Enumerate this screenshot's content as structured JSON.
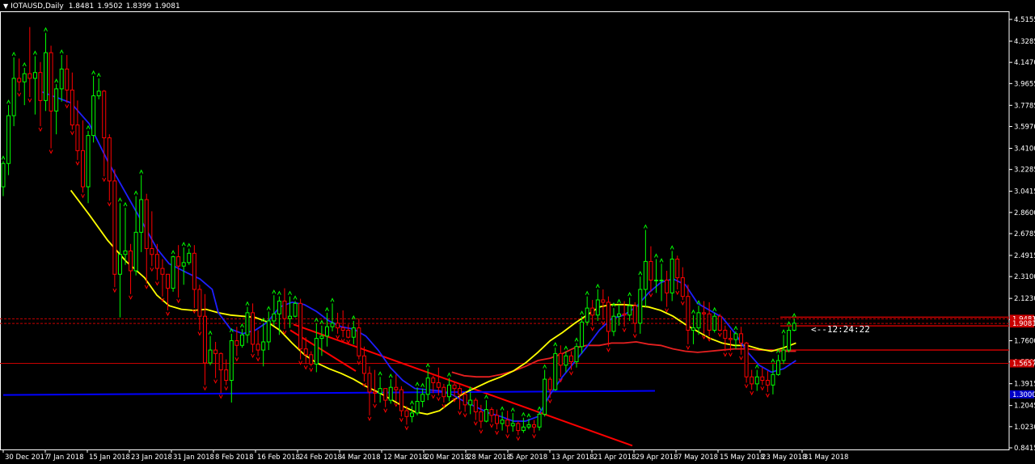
{
  "header": {
    "symbol": "IOTAUSD,Daily",
    "open": "1.8481",
    "high": "1.9502",
    "low": "1.8399",
    "close": "1.9081"
  },
  "countdown": "<--12:24:22",
  "colors": {
    "background": "#000000",
    "bull": "#00ff00",
    "bear": "#ff0000",
    "ma_fast": "#1e1eff",
    "ma_mid": "#ffff00",
    "ma_slow": "#e62020",
    "trend_red": "#ff0000",
    "trend_blue": "#0000ff",
    "hline_red": "#c80000",
    "axis": "#ffffff"
  },
  "chart_data": {
    "type": "candlestick",
    "title": "IOTAUSD,Daily",
    "ylim": [
      0.8415,
      4.5155
    ],
    "y_ticks": [
      "4.5155",
      "4.3285",
      "4.1470",
      "3.9655",
      "3.7785",
      "3.5970",
      "3.4100",
      "3.2285",
      "3.0415",
      "2.8600",
      "2.6785",
      "2.4915",
      "2.3100",
      "2.1230",
      "1.9415",
      "1.7600",
      "1.5785",
      "1.3915",
      "1.2045",
      "1.0230",
      "0.8415"
    ],
    "x_ticks": [
      "30 Dec 2017",
      "7 Jan 2018",
      "15 Jan 2018",
      "23 Jan 2018",
      "31 Jan 2018",
      "8 Feb 2018",
      "16 Feb 2018",
      "24 Feb 2018",
      "4 Mar 2018",
      "12 Mar 2018",
      "20 Mar 2018",
      "28 Mar 2018",
      "5 Apr 2018",
      "13 Apr 2018",
      "21 Apr 2018",
      "29 Apr 2018",
      "7 May 2018",
      "15 May 2018",
      "23 May 2018",
      "31 May 2018"
    ],
    "price_badges": [
      {
        "value": "1.9481",
        "color": "#c80000"
      },
      {
        "value": "1.9081",
        "color": "#c80000"
      },
      {
        "value": "1.5657",
        "color": "#c80000"
      },
      {
        "value": "1.3000",
        "color": "#0000c8"
      }
    ],
    "horizontal_lines": [
      {
        "y": 1.948,
        "color": "#c80000",
        "style": "dashed"
      },
      {
        "y": 1.908,
        "color": "#c80000",
        "style": "dashed"
      },
      {
        "y": 1.566,
        "color": "#c80000",
        "style": "solid"
      }
    ],
    "candles": [
      [
        3.08,
        3.28,
        3.0,
        3.3
      ],
      [
        3.28,
        3.69,
        3.18,
        3.78
      ],
      [
        3.69,
        4.01,
        3.6,
        4.19
      ],
      [
        4.01,
        3.98,
        3.9,
        4.18
      ],
      [
        3.98,
        4.05,
        3.78,
        4.1
      ],
      [
        4.05,
        4.01,
        3.85,
        4.45
      ],
      [
        4.01,
        4.06,
        3.7,
        4.2
      ],
      [
        4.06,
        3.82,
        3.6,
        4.15
      ],
      [
        3.82,
        4.23,
        3.73,
        4.4
      ],
      [
        4.23,
        3.73,
        3.41,
        4.29
      ],
      [
        3.73,
        3.92,
        3.53,
        3.96
      ],
      [
        3.92,
        4.09,
        3.81,
        4.21
      ],
      [
        4.09,
        3.91,
        3.8,
        4.21
      ],
      [
        3.91,
        3.61,
        3.57,
        4.06
      ],
      [
        3.61,
        3.39,
        3.31,
        3.82
      ],
      [
        3.39,
        3.08,
        3.03,
        3.65
      ],
      [
        3.08,
        3.52,
        2.94,
        3.56
      ],
      [
        3.52,
        3.86,
        3.46,
        4.03
      ],
      [
        3.86,
        3.9,
        3.83,
        4.01
      ],
      [
        3.9,
        3.5,
        3.17,
        3.91
      ],
      [
        3.5,
        3.13,
        2.96,
        3.53
      ],
      [
        3.13,
        2.33,
        2.22,
        3.23
      ],
      [
        2.33,
        2.5,
        1.96,
        2.94
      ],
      [
        2.5,
        2.53,
        2.41,
        2.9
      ],
      [
        2.53,
        2.36,
        2.16,
        2.59
      ],
      [
        2.36,
        2.69,
        2.32,
        3.0
      ],
      [
        2.69,
        2.97,
        2.52,
        3.18
      ],
      [
        2.97,
        2.55,
        2.25,
        3.02
      ],
      [
        2.55,
        2.5,
        2.4,
        2.87
      ],
      [
        2.5,
        2.38,
        2.28,
        2.59
      ],
      [
        2.38,
        2.33,
        2.14,
        2.46
      ],
      [
        2.33,
        2.21,
        2.02,
        2.33
      ],
      [
        2.21,
        2.48,
        2.18,
        2.49
      ],
      [
        2.48,
        2.4,
        2.13,
        2.58
      ],
      [
        2.4,
        2.43,
        2.24,
        2.56
      ],
      [
        2.43,
        2.51,
        2.41,
        2.55
      ],
      [
        2.51,
        2.2,
        2.04,
        2.58
      ],
      [
        2.2,
        1.97,
        1.85,
        2.24
      ],
      [
        1.97,
        1.57,
        1.38,
        2.16
      ],
      [
        1.57,
        1.68,
        1.55,
        1.8
      ],
      [
        1.68,
        1.65,
        1.44,
        1.75
      ],
      [
        1.65,
        1.51,
        1.31,
        1.66
      ],
      [
        1.51,
        1.42,
        1.38,
        1.6
      ],
      [
        1.42,
        1.76,
        1.23,
        1.82
      ],
      [
        1.76,
        1.72,
        1.63,
        1.88
      ],
      [
        1.72,
        1.81,
        1.7,
        1.86
      ],
      [
        1.81,
        2.0,
        1.74,
        2.05
      ],
      [
        2.0,
        1.73,
        1.66,
        2.08
      ],
      [
        1.73,
        1.68,
        1.63,
        1.85
      ],
      [
        1.68,
        1.75,
        1.54,
        1.91
      ],
      [
        1.75,
        1.93,
        1.68,
        2.01
      ],
      [
        1.93,
        1.99,
        1.89,
        2.15
      ],
      [
        1.99,
        2.1,
        1.81,
        2.14
      ],
      [
        2.1,
        1.95,
        1.86,
        2.21
      ],
      [
        1.95,
        1.97,
        1.87,
        2.14
      ],
      [
        1.97,
        2.08,
        1.96,
        2.1
      ],
      [
        2.08,
        1.69,
        1.6,
        2.12
      ],
      [
        1.69,
        1.64,
        1.56,
        1.79
      ],
      [
        1.64,
        1.56,
        1.54,
        1.67
      ],
      [
        1.56,
        1.78,
        1.49,
        1.91
      ],
      [
        1.78,
        1.8,
        1.63,
        1.89
      ],
      [
        1.8,
        1.88,
        1.71,
        2.0
      ],
      [
        1.88,
        1.91,
        1.84,
        2.08
      ],
      [
        1.91,
        1.87,
        1.82,
        2.0
      ],
      [
        1.87,
        1.85,
        1.79,
        2.02
      ],
      [
        1.85,
        1.79,
        1.78,
        1.9
      ],
      [
        1.79,
        1.87,
        1.73,
        1.93
      ],
      [
        1.87,
        1.63,
        1.6,
        1.95
      ],
      [
        1.63,
        1.48,
        1.41,
        1.71
      ],
      [
        1.48,
        1.32,
        1.12,
        1.54
      ],
      [
        1.32,
        1.31,
        1.23,
        1.51
      ],
      [
        1.31,
        1.35,
        1.23,
        1.45
      ],
      [
        1.35,
        1.25,
        1.19,
        1.35
      ],
      [
        1.25,
        1.36,
        1.22,
        1.43
      ],
      [
        1.36,
        1.34,
        1.24,
        1.47
      ],
      [
        1.34,
        1.16,
        1.11,
        1.37
      ],
      [
        1.16,
        1.11,
        1.04,
        1.2
      ],
      [
        1.11,
        1.14,
        1.06,
        1.2
      ],
      [
        1.14,
        1.24,
        1.12,
        1.36
      ],
      [
        1.24,
        1.3,
        1.19,
        1.35
      ],
      [
        1.3,
        1.44,
        1.25,
        1.52
      ],
      [
        1.44,
        1.4,
        1.31,
        1.46
      ],
      [
        1.4,
        1.36,
        1.29,
        1.53
      ],
      [
        1.36,
        1.28,
        1.23,
        1.39
      ],
      [
        1.28,
        1.38,
        1.24,
        1.44
      ],
      [
        1.38,
        1.35,
        1.28,
        1.41
      ],
      [
        1.35,
        1.3,
        1.17,
        1.38
      ],
      [
        1.3,
        1.21,
        1.15,
        1.32
      ],
      [
        1.21,
        1.25,
        1.13,
        1.32
      ],
      [
        1.25,
        1.15,
        1.08,
        1.27
      ],
      [
        1.15,
        1.07,
        1.01,
        1.21
      ],
      [
        1.07,
        1.17,
        1.06,
        1.25
      ],
      [
        1.17,
        1.12,
        1.06,
        1.19
      ],
      [
        1.12,
        1.05,
        1.0,
        1.17
      ],
      [
        1.05,
        1.08,
        0.99,
        1.15
      ],
      [
        1.08,
        1.03,
        0.97,
        1.16
      ],
      [
        1.03,
        1.05,
        0.98,
        1.14
      ],
      [
        1.05,
        0.99,
        0.95,
        1.07
      ],
      [
        0.99,
        1.02,
        0.97,
        1.1
      ],
      [
        1.02,
        1.04,
        1.0,
        1.09
      ],
      [
        1.04,
        1.02,
        0.97,
        1.08
      ],
      [
        1.02,
        1.13,
        0.99,
        1.15
      ],
      [
        1.13,
        1.43,
        1.11,
        1.51
      ],
      [
        1.43,
        1.34,
        1.27,
        1.45
      ],
      [
        1.34,
        1.65,
        1.33,
        1.7
      ],
      [
        1.65,
        1.55,
        1.45,
        1.72
      ],
      [
        1.55,
        1.63,
        1.49,
        1.67
      ],
      [
        1.63,
        1.58,
        1.51,
        1.67
      ],
      [
        1.58,
        1.71,
        1.53,
        1.74
      ],
      [
        1.71,
        1.92,
        1.65,
        1.97
      ],
      [
        1.92,
        2.04,
        1.89,
        2.14
      ],
      [
        2.04,
        1.98,
        1.89,
        2.11
      ],
      [
        1.98,
        2.11,
        1.93,
        2.2
      ],
      [
        2.11,
        2.09,
        1.94,
        2.2
      ],
      [
        2.09,
        1.84,
        1.71,
        2.14
      ],
      [
        1.84,
        1.97,
        1.8,
        2.04
      ],
      [
        1.97,
        1.99,
        1.89,
        2.07
      ],
      [
        1.99,
        1.98,
        1.88,
        2.1
      ],
      [
        1.98,
        2.06,
        1.93,
        2.13
      ],
      [
        2.06,
        1.91,
        1.83,
        2.09
      ],
      [
        1.91,
        2.2,
        1.82,
        2.31
      ],
      [
        2.2,
        2.44,
        2.05,
        2.71
      ],
      [
        2.44,
        2.28,
        2.18,
        2.57
      ],
      [
        2.28,
        2.28,
        2.17,
        2.46
      ],
      [
        2.28,
        2.28,
        2.1,
        2.42
      ],
      [
        2.28,
        2.17,
        2.05,
        2.36
      ],
      [
        2.17,
        2.46,
        2.1,
        2.53
      ],
      [
        2.46,
        2.3,
        2.2,
        2.49
      ],
      [
        2.3,
        2.14,
        2.11,
        2.39
      ],
      [
        2.14,
        1.85,
        1.73,
        2.24
      ],
      [
        1.85,
        1.87,
        1.73,
        1.98
      ],
      [
        1.87,
        2.0,
        1.81,
        2.06
      ],
      [
        2.0,
        1.99,
        1.82,
        2.1
      ],
      [
        1.99,
        1.85,
        1.8,
        2.09
      ],
      [
        1.85,
        1.97,
        1.83,
        2.0
      ],
      [
        1.97,
        1.85,
        1.84,
        1.99
      ],
      [
        1.85,
        1.78,
        1.67,
        1.89
      ],
      [
        1.78,
        1.77,
        1.67,
        1.85
      ],
      [
        1.77,
        1.82,
        1.69,
        1.84
      ],
      [
        1.82,
        1.74,
        1.64,
        1.88
      ],
      [
        1.74,
        1.45,
        1.4,
        1.75
      ],
      [
        1.45,
        1.39,
        1.34,
        1.51
      ],
      [
        1.39,
        1.45,
        1.33,
        1.51
      ],
      [
        1.45,
        1.42,
        1.38,
        1.53
      ],
      [
        1.42,
        1.38,
        1.32,
        1.5
      ],
      [
        1.38,
        1.47,
        1.3,
        1.56
      ],
      [
        1.47,
        1.59,
        1.46,
        1.64
      ],
      [
        1.59,
        1.68,
        1.56,
        1.81
      ],
      [
        1.68,
        1.85,
        1.66,
        1.88
      ],
      [
        1.85,
        1.91,
        1.84,
        1.95
      ]
    ],
    "ma_fast": [
      [
        30,
        3.9
      ],
      [
        40,
        3.86
      ],
      [
        55,
        3.8
      ],
      [
        70,
        3.62
      ],
      [
        85,
        3.3
      ],
      [
        100,
        3.02
      ],
      [
        115,
        2.74
      ],
      [
        125,
        2.55
      ],
      [
        135,
        2.42
      ],
      [
        150,
        2.34
      ],
      [
        160,
        2.29
      ],
      [
        170,
        2.2
      ],
      [
        175,
        2.0
      ],
      [
        185,
        1.86
      ],
      [
        195,
        1.82
      ],
      [
        205,
        1.85
      ],
      [
        215,
        1.92
      ],
      [
        225,
        2.05
      ],
      [
        235,
        2.09
      ],
      [
        245,
        2.07
      ],
      [
        255,
        2.01
      ],
      [
        265,
        1.93
      ],
      [
        275,
        1.88
      ],
      [
        285,
        1.86
      ],
      [
        295,
        1.8
      ],
      [
        305,
        1.68
      ],
      [
        315,
        1.53
      ],
      [
        325,
        1.42
      ],
      [
        335,
        1.35
      ],
      [
        345,
        1.34
      ],
      [
        355,
        1.33
      ],
      [
        365,
        1.3
      ],
      [
        375,
        1.24
      ],
      [
        385,
        1.19
      ],
      [
        395,
        1.14
      ],
      [
        405,
        1.11
      ],
      [
        415,
        1.07
      ],
      [
        425,
        1.07
      ],
      [
        435,
        1.11
      ],
      [
        445,
        1.3
      ],
      [
        455,
        1.45
      ],
      [
        465,
        1.58
      ],
      [
        475,
        1.71
      ],
      [
        485,
        1.85
      ],
      [
        495,
        1.95
      ],
      [
        505,
        1.98
      ],
      [
        515,
        2.05
      ],
      [
        525,
        2.17
      ],
      [
        535,
        2.26
      ],
      [
        545,
        2.29
      ],
      [
        555,
        2.24
      ],
      [
        565,
        2.08
      ],
      [
        575,
        2.02
      ],
      [
        585,
        1.96
      ],
      [
        595,
        1.83
      ],
      [
        605,
        1.67
      ],
      [
        615,
        1.55
      ],
      [
        625,
        1.49
      ],
      [
        635,
        1.52
      ],
      [
        645,
        1.59
      ]
    ],
    "ma_mid": [
      [
        55,
        3.05
      ],
      [
        70,
        2.84
      ],
      [
        85,
        2.62
      ],
      [
        100,
        2.44
      ],
      [
        115,
        2.3
      ],
      [
        125,
        2.15
      ],
      [
        135,
        2.06
      ],
      [
        145,
        2.03
      ],
      [
        155,
        2.02
      ],
      [
        165,
        2.03
      ],
      [
        175,
        2.0
      ],
      [
        185,
        1.98
      ],
      [
        195,
        1.97
      ],
      [
        205,
        1.96
      ],
      [
        215,
        1.92
      ],
      [
        225,
        1.85
      ],
      [
        235,
        1.74
      ],
      [
        245,
        1.64
      ],
      [
        255,
        1.57
      ],
      [
        265,
        1.52
      ],
      [
        275,
        1.48
      ],
      [
        285,
        1.43
      ],
      [
        295,
        1.37
      ],
      [
        305,
        1.32
      ],
      [
        315,
        1.26
      ],
      [
        325,
        1.2
      ],
      [
        335,
        1.15
      ],
      [
        345,
        1.13
      ],
      [
        355,
        1.16
      ],
      [
        365,
        1.24
      ],
      [
        375,
        1.31
      ],
      [
        385,
        1.36
      ],
      [
        395,
        1.41
      ],
      [
        405,
        1.45
      ],
      [
        415,
        1.5
      ],
      [
        425,
        1.57
      ],
      [
        435,
        1.66
      ],
      [
        445,
        1.76
      ],
      [
        455,
        1.83
      ],
      [
        465,
        1.91
      ],
      [
        475,
        1.98
      ],
      [
        485,
        2.05
      ],
      [
        495,
        2.07
      ],
      [
        505,
        2.07
      ],
      [
        515,
        2.06
      ],
      [
        525,
        2.05
      ],
      [
        535,
        2.02
      ],
      [
        545,
        1.97
      ],
      [
        555,
        1.9
      ],
      [
        565,
        1.84
      ],
      [
        575,
        1.78
      ],
      [
        585,
        1.74
      ],
      [
        595,
        1.72
      ],
      [
        605,
        1.72
      ],
      [
        615,
        1.69
      ],
      [
        625,
        1.67
      ],
      [
        635,
        1.7
      ],
      [
        645,
        1.74
      ]
    ],
    "ma_slow": [
      [
        365,
        1.49
      ],
      [
        375,
        1.46
      ],
      [
        385,
        1.45
      ],
      [
        395,
        1.45
      ],
      [
        405,
        1.47
      ],
      [
        415,
        1.5
      ],
      [
        425,
        1.54
      ],
      [
        435,
        1.59
      ],
      [
        445,
        1.61
      ],
      [
        455,
        1.65
      ],
      [
        465,
        1.7
      ],
      [
        475,
        1.72
      ],
      [
        485,
        1.72
      ],
      [
        495,
        1.74
      ],
      [
        505,
        1.74
      ],
      [
        515,
        1.75
      ],
      [
        525,
        1.73
      ],
      [
        535,
        1.72
      ],
      [
        545,
        1.69
      ],
      [
        555,
        1.67
      ],
      [
        565,
        1.66
      ],
      [
        575,
        1.67
      ],
      [
        585,
        1.68
      ],
      [
        595,
        1.69
      ],
      [
        605,
        1.69
      ],
      [
        615,
        1.68
      ],
      [
        625,
        1.68
      ],
      [
        635,
        1.67
      ],
      [
        645,
        1.67
      ]
    ],
    "trend_lines": [
      {
        "color": "#ff0000",
        "from": [
          359,
          1.9
        ],
        "to": [
          782,
          0.86
        ]
      },
      {
        "color": "#ff0000",
        "from": [
          355,
          1.85
        ],
        "to": [
          440,
          1.5
        ]
      },
      {
        "color": "#0000ff",
        "from": [
          0,
          1.295
        ],
        "to": [
          810,
          1.33
        ]
      }
    ]
  }
}
